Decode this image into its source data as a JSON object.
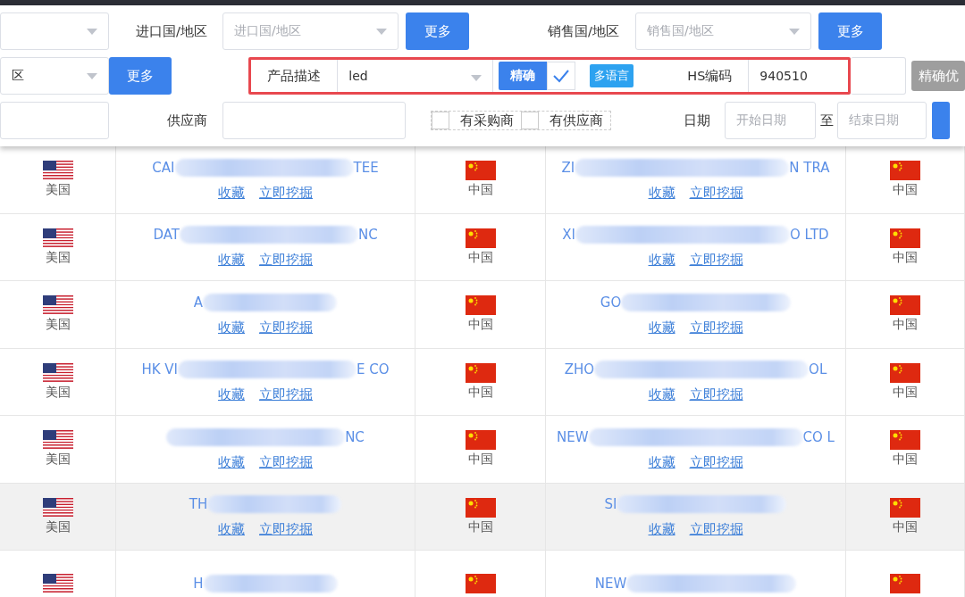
{
  "filters": {
    "importer_country": {
      "label": "进口国/地区",
      "placeholder": "进口国/地区",
      "more_button": "更多"
    },
    "sales_country": {
      "label": "销售国/地区",
      "placeholder": "销售国/地区",
      "more_button": "更多"
    },
    "left_select_2": {
      "value": "区",
      "more_button": "更多"
    },
    "product_description": {
      "label": "产品描述",
      "value": "led",
      "exact_button": "精确",
      "exact_checked": true,
      "multilang_tag": "多语言",
      "highlighted": true
    },
    "hs_code": {
      "label": "HS编码",
      "value": "940510"
    },
    "exact_priority_button": {
      "label": "精确优",
      "disabled": true
    },
    "supplier": {
      "label": "供应商"
    },
    "options": [
      {
        "label": "有采购商",
        "checked": false
      },
      {
        "label": "有供应商",
        "checked": false
      }
    ],
    "date": {
      "label": "日期",
      "start_placeholder": "开始日期",
      "separator": "至",
      "end_placeholder": "结束日期"
    }
  },
  "rows": [
    {
      "buyer_country": "美国",
      "buyer_name_start": "CAI",
      "buyer_name_end": "TEE",
      "buyer_links": [
        "收藏",
        "立即挖掘"
      ],
      "supplier_country": "中国",
      "supplier_name_start": "ZI",
      "supplier_name_end": "N TRA",
      "supplier_links": [
        "收藏",
        "立即挖掘"
      ],
      "destination_country": "中国",
      "highlighted": false
    },
    {
      "buyer_country": "美国",
      "buyer_name_start": "DAT",
      "buyer_name_end": "NC",
      "buyer_links": [
        "收藏",
        "立即挖掘"
      ],
      "supplier_country": "中国",
      "supplier_name_start": "XI",
      "supplier_name_end": "O LTD",
      "supplier_links": [
        "收藏",
        "立即挖掘"
      ],
      "destination_country": "中国",
      "highlighted": false
    },
    {
      "buyer_country": "美国",
      "buyer_name_start": "A",
      "buyer_links": [
        "收藏",
        "立即挖掘"
      ],
      "supplier_country": "中国",
      "supplier_name_start": "GO",
      "supplier_links": [
        "收藏",
        "立即挖掘"
      ],
      "destination_country": "中国",
      "highlighted": false
    },
    {
      "buyer_country": "美国",
      "buyer_name_start": "HK VI",
      "buyer_name_end": "E CO",
      "buyer_links": [
        "收藏",
        "立即挖掘"
      ],
      "supplier_country": "中国",
      "supplier_name_start": "ZHO",
      "supplier_name_end": "OL",
      "supplier_links": [
        "收藏",
        "立即挖掘"
      ],
      "destination_country": "中国",
      "highlighted": false
    },
    {
      "buyer_country": "美国",
      "buyer_name_end": "NC",
      "buyer_links": [
        "收藏",
        "立即挖掘"
      ],
      "supplier_country": "中国",
      "supplier_name_start": "NEW",
      "supplier_name_end": "CO L",
      "supplier_links": [
        "收藏",
        "立即挖掘"
      ],
      "destination_country": "中国",
      "highlighted": false
    },
    {
      "buyer_country": "美国",
      "buyer_name_start": "TH",
      "buyer_links": [
        "收藏",
        "立即挖掘"
      ],
      "supplier_country": "中国",
      "supplier_name_start": "SI",
      "supplier_links": [
        "收藏",
        "立即挖掘"
      ],
      "destination_country": "中国",
      "highlighted": true
    },
    {
      "buyer_name_start": "H",
      "supplier_name_start": "NEW",
      "highlighted": false
    }
  ]
}
